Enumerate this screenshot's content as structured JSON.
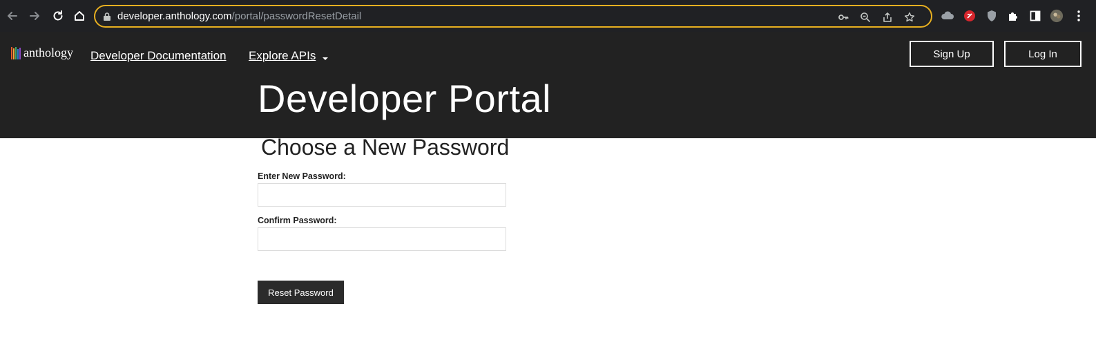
{
  "browser": {
    "url_host": "developer.anthology.com",
    "url_path": "/portal/passwordResetDetail"
  },
  "header": {
    "logo_text": "anthology",
    "nav": {
      "docs_label": "Developer Documentation",
      "apis_label": "Explore APIs"
    },
    "signup_label": "Sign Up",
    "login_label": "Log In",
    "portal_title": "Developer Portal"
  },
  "form": {
    "title": "Choose a New Password",
    "new_password_label": "Enter New Password:",
    "new_password_value": "",
    "confirm_password_label": "Confirm Password:",
    "confirm_password_value": "",
    "submit_label": "Reset Password"
  },
  "colors": {
    "header_bg": "#222222",
    "omnibox_border": "#e8b020",
    "button_bg": "#2b2b2b"
  }
}
